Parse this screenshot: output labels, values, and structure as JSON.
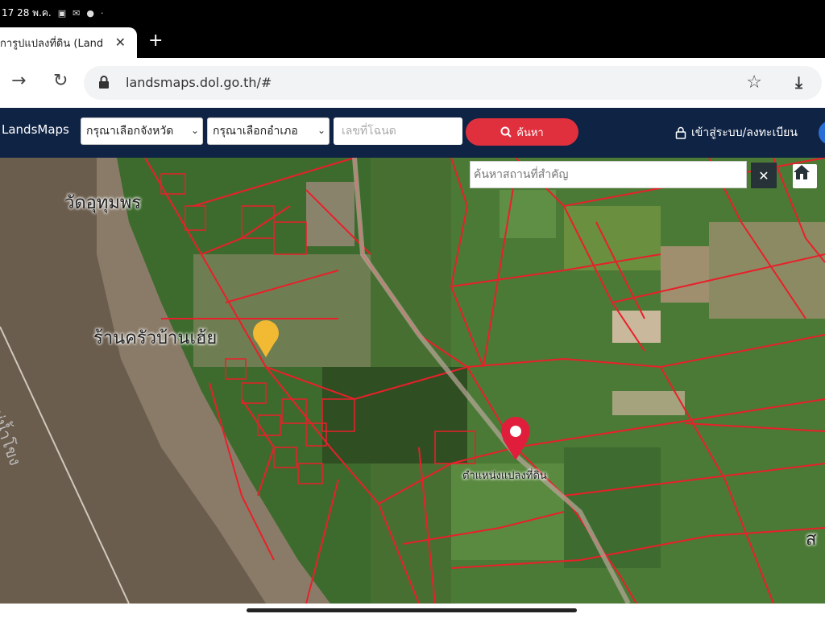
{
  "status_bar": {
    "date": "17 28 พ.ค.",
    "icons": [
      "photo-icon",
      "mail-icon",
      "line-icon",
      "dot-icon"
    ]
  },
  "tab": {
    "title": "การูปแปลงที่ดิน (Land",
    "close": "✕"
  },
  "new_tab": "+",
  "address": {
    "url": "landsmaps.dol.go.th/#"
  },
  "site": {
    "logo": "LandsMaps",
    "province_select": "กรุณาเลือกจังหวัด",
    "district_select": "กรุณาเลือกอำเภอ",
    "deed_placeholder": "เลขที่โฉนด",
    "search_button": "ค้นหา",
    "login": "เข้าสู่ระบบ/ลงทะเบียน"
  },
  "map": {
    "place_search_placeholder": "ค้นหาสถานที่สำคัญ",
    "clear": "✕",
    "labels": {
      "temple": "วัดอุทุมพร",
      "restaurant": "ร้านครัวบ้านเฮ้ย",
      "parcel_position": "ตำแหน่งแปลงที่ดิน",
      "river": "แม่น้ำโขง",
      "edge": "ส"
    }
  },
  "colors": {
    "navbar": "#0f2344",
    "search_button": "#e0303e",
    "parcel_lines": "#e8202a",
    "pin": "#e01e3c"
  }
}
